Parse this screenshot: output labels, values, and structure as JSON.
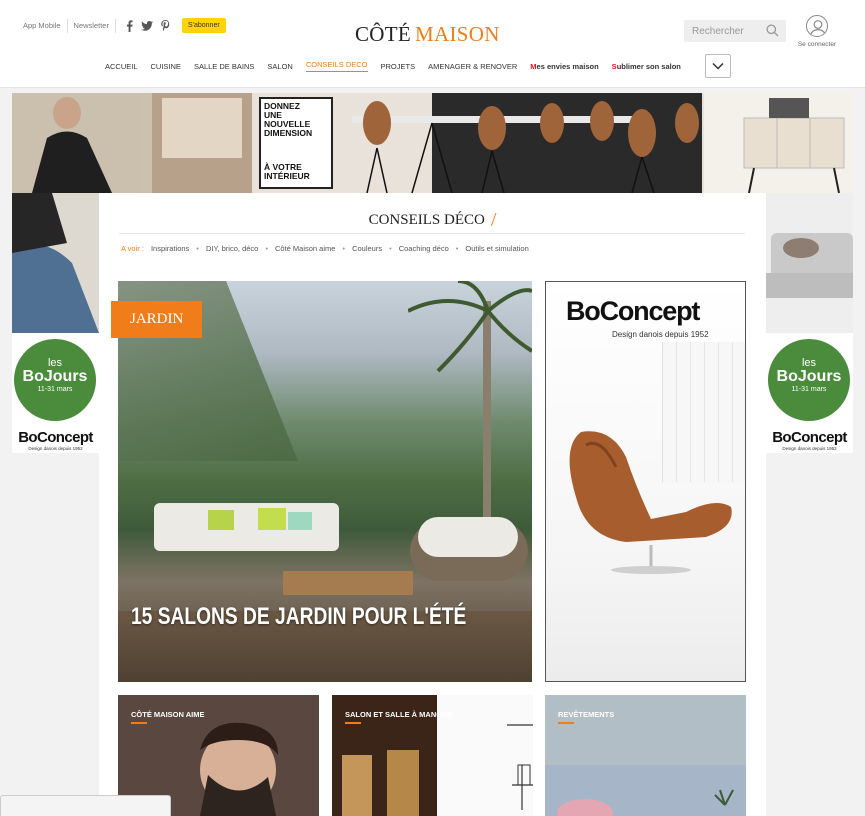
{
  "header": {
    "top_links": [
      "App Mobile",
      "Newsletter"
    ],
    "subscribe_label": "S'abonner",
    "logo_part1": "CÔTÉ",
    "logo_part2": "MAISON",
    "search_placeholder": "Rechercher",
    "login_label": "Se connecter",
    "social_icons": [
      "facebook-icon",
      "twitter-icon",
      "pinterest-icon"
    ]
  },
  "nav": {
    "items": [
      {
        "label": "ACCUEIL"
      },
      {
        "label": "CUISINE"
      },
      {
        "label": "SALLE DE BAINS"
      },
      {
        "label": "SALON"
      },
      {
        "label": "CONSEILS DECO",
        "active": true
      },
      {
        "label": "PROJETS"
      },
      {
        "label": "AMENAGER & RENOVER"
      }
    ],
    "special": [
      {
        "first": "M",
        "rest": "es envies maison"
      },
      {
        "first": "S",
        "rest": "ublimer son salon"
      }
    ]
  },
  "ad_banner": {
    "line1": "DONNEZ",
    "line2": "UNE",
    "line3": "NOUVELLE",
    "line4": "DIMENSION",
    "line5": "À VOTRE",
    "line6": "INTÉRIEUR"
  },
  "side_ad": {
    "les": "les",
    "bojours": "BoJours",
    "dates": "11-31 mars",
    "brand": "BoConcept",
    "tagline": "Design danois depuis 1952"
  },
  "section": {
    "title": "CONSEILS DÉCO",
    "subnav_label": "A voir :",
    "subnav": [
      "Inspirations",
      "DIY, brico, déco",
      "Côté Maison aime",
      "Couleurs",
      "Coaching déco",
      "Outils et simulation"
    ]
  },
  "feature": {
    "category": "JARDIN",
    "title": "15 SALONS DE JARDIN POUR L'ÉTÉ"
  },
  "ad2": {
    "brand": "BoConcept",
    "tagline": "Design danois depuis 1952"
  },
  "cards": [
    {
      "label": "CÔTÉ MAISON AIME"
    },
    {
      "label": "SALON ET SALLE À MANGER"
    },
    {
      "label": "REVÊTEMENTS"
    }
  ],
  "colors": {
    "accent": "#f07d1a",
    "subscribe": "#ffd400",
    "bojours_green": "#4a8b3c"
  }
}
